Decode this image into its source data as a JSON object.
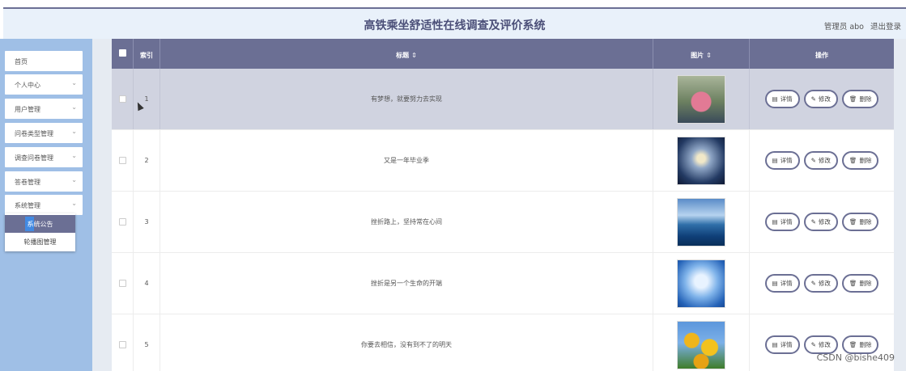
{
  "header": {
    "title": "高铁乘坐舒适性在线调查及评价系统",
    "user": "管理员 abo",
    "logout": "退出登录"
  },
  "sidebar": {
    "items": [
      {
        "label": "首页",
        "has_arrow": false
      },
      {
        "label": "个人中心",
        "has_arrow": true
      },
      {
        "label": "用户管理",
        "has_arrow": true
      },
      {
        "label": "问卷类型管理",
        "has_arrow": true
      },
      {
        "label": "调查问卷管理",
        "has_arrow": true
      },
      {
        "label": "答卷管理",
        "has_arrow": true
      },
      {
        "label": "系统管理",
        "has_arrow": true
      }
    ],
    "submenu": [
      {
        "label": "系统公告",
        "active": true
      },
      {
        "label": "轮播图管理",
        "active": false
      }
    ]
  },
  "table": {
    "headers": {
      "index": "索引",
      "title": "标题",
      "image": "图片",
      "actions": "操作"
    },
    "rows": [
      {
        "index": "1",
        "title": "有梦想，就要努力去实现",
        "image": "flowers-image",
        "highlighted": true
      },
      {
        "index": "2",
        "title": "又是一年毕业季",
        "image": "graduation-image",
        "highlighted": false
      },
      {
        "index": "3",
        "title": "挫折路上，坚持常在心间",
        "image": "lake-image",
        "highlighted": false
      },
      {
        "index": "4",
        "title": "挫折是另一个生命的开端",
        "image": "sky-image",
        "highlighted": false
      },
      {
        "index": "5",
        "title": "你要去相信，没有到不了的明天",
        "image": "sunflower-image",
        "highlighted": false
      }
    ],
    "buttons": {
      "detail": "详情",
      "edit": "修改",
      "delete": "删除"
    }
  },
  "watermark": "CSDN @bishe409"
}
